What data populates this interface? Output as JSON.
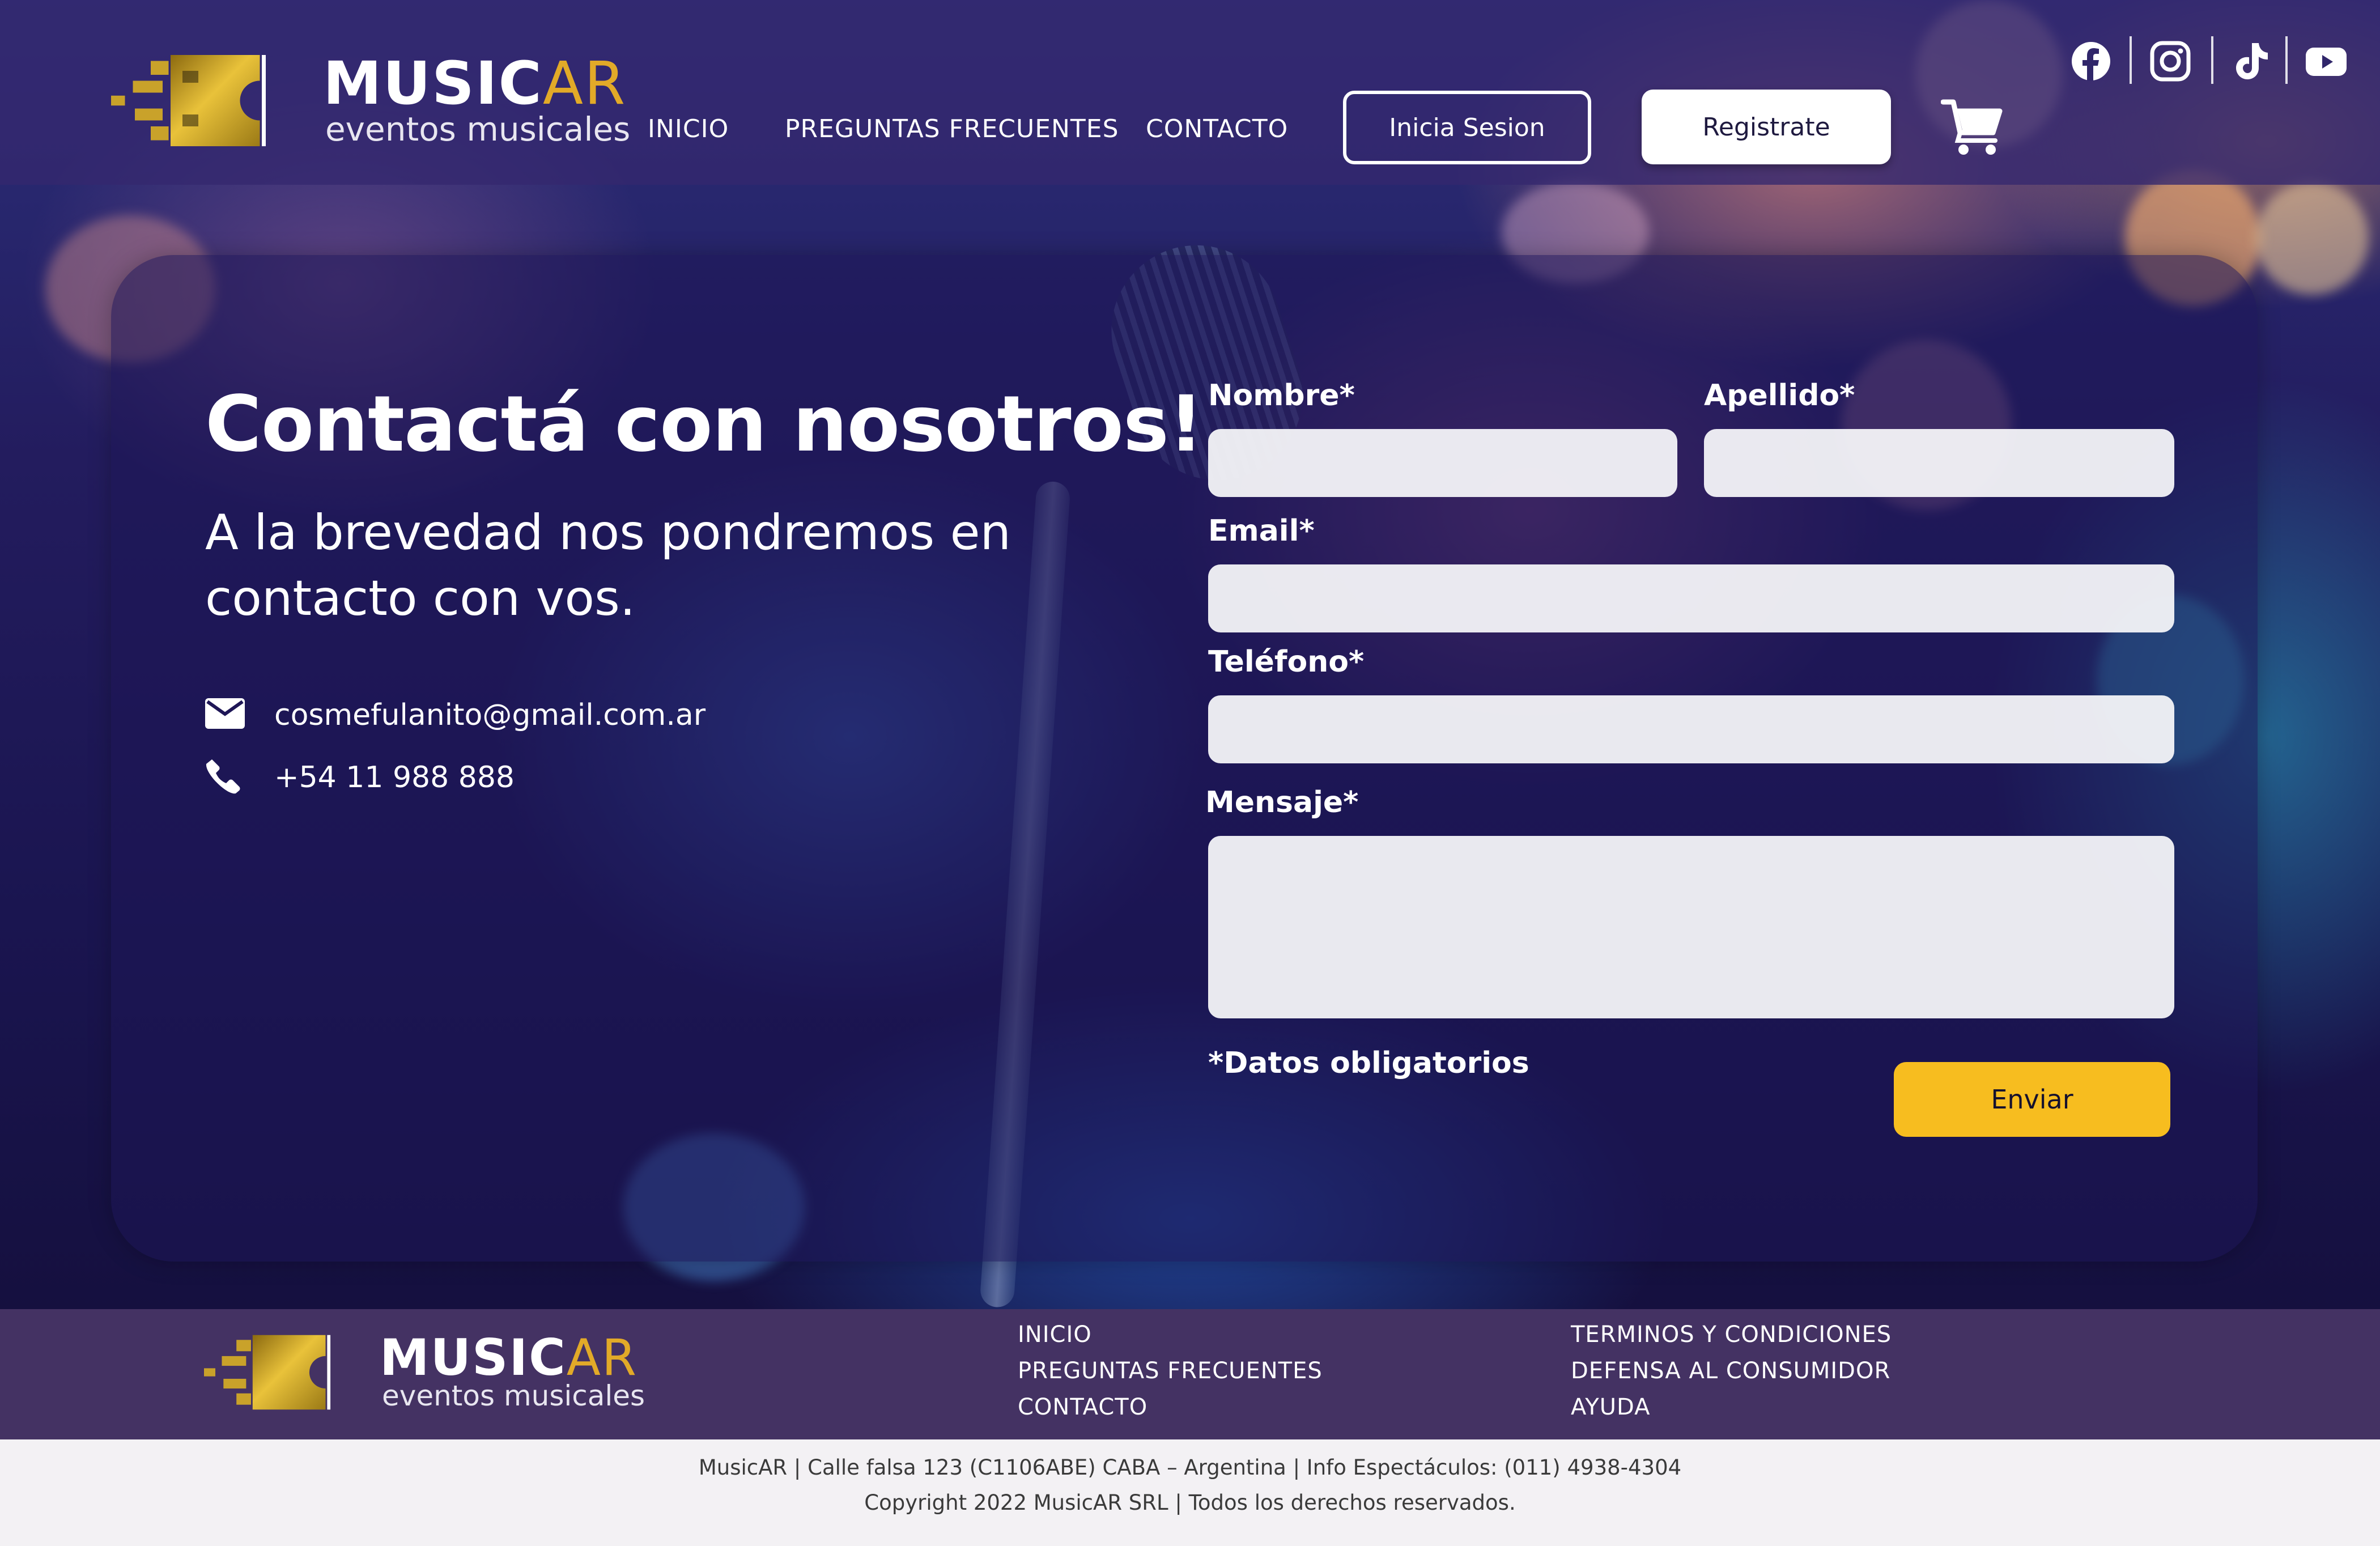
{
  "brand": {
    "name_main": "MUSIC",
    "name_accent": "AR",
    "tagline": "eventos musicales"
  },
  "header": {
    "nav": [
      {
        "label": "INICIO"
      },
      {
        "label": "PREGUNTAS FRECUENTES"
      },
      {
        "label": "CONTACTO"
      }
    ],
    "login_label": "Inicia Sesion",
    "register_label": "Registrate",
    "social": [
      "facebook-icon",
      "instagram-icon",
      "tiktok-icon",
      "youtube-icon"
    ]
  },
  "contact": {
    "title": "Contactá con nosotros!",
    "subtitle": "A la brevedad nos pondremos en contacto con vos.",
    "email": "cosmefulanito@gmail.com.ar",
    "phone": "+54 11 988 888"
  },
  "form": {
    "nombre_label": "Nombre*",
    "nombre_value": "",
    "apellido_label": "Apellido*",
    "apellido_value": "",
    "email_label": "Email*",
    "email_value": "",
    "telefono_label": "Teléfono*",
    "telefono_value": "",
    "mensaje_label": "Mensaje*",
    "mensaje_value": "",
    "required_note": "*Datos obligatorios",
    "submit_label": "Enviar"
  },
  "footer": {
    "links_col1": [
      "INICIO",
      "PREGUNTAS FRECUENTES",
      "CONTACTO"
    ],
    "links_col2": [
      "TERMINOS Y CONDICIONES",
      "DEFENSA AL CONSUMIDOR",
      "AYUDA"
    ],
    "company_info": "MusicAR | Calle falsa 123 (C1106ABE) CABA – Argentina | Info Espectáculos: (011) 4938-4304",
    "copyright": "Copyright 2022 MusicAR SRL | Todos los derechos reservados."
  },
  "colors": {
    "accent_gold": "#e2aa28",
    "submit_yellow": "#f7bd1f",
    "header_bg": "#34286e",
    "footer_bg": "#443263",
    "bottom_bar_bg": "#f3f1f4"
  }
}
